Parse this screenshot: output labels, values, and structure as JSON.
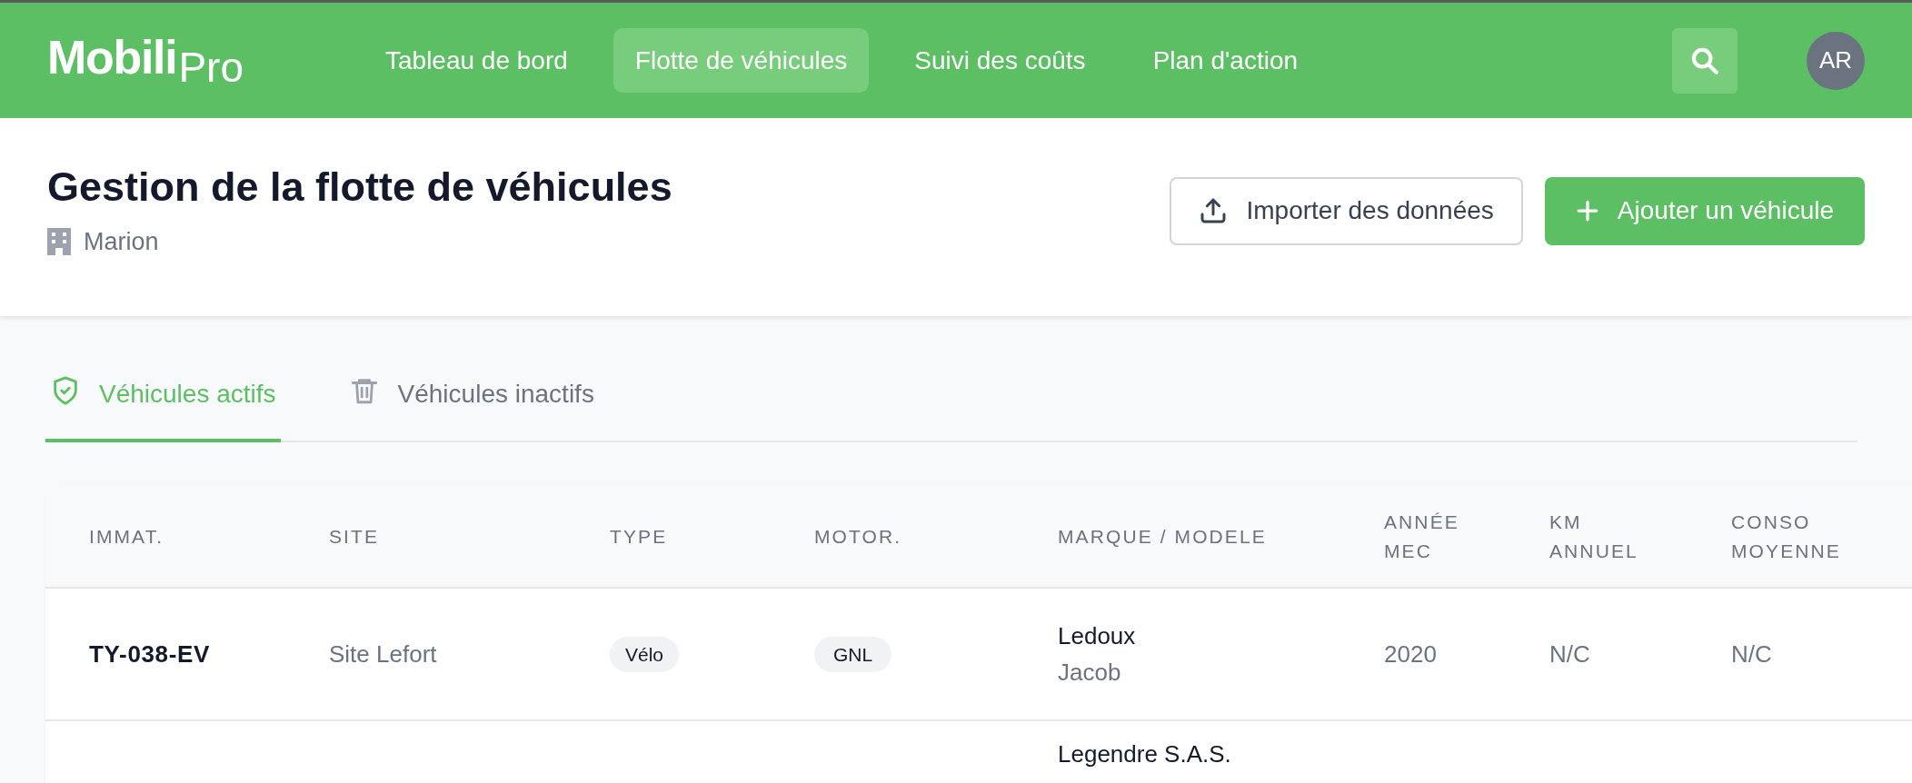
{
  "header": {
    "logo": {
      "main": "Mobili",
      "suffix": "Pro"
    },
    "nav": [
      {
        "label": "Tableau de bord",
        "selected": false
      },
      {
        "label": "Flotte de véhicules",
        "selected": true
      },
      {
        "label": "Suivi des coûts",
        "selected": false
      },
      {
        "label": "Plan d'action",
        "selected": false
      }
    ],
    "avatar": "AR"
  },
  "page": {
    "title": "Gestion de la flotte de véhicules",
    "site": "Marion",
    "buttons": [
      {
        "kind": "secondary",
        "label": "Importer des données"
      },
      {
        "kind": "primary",
        "label": "Ajouter un véhicule"
      }
    ]
  },
  "tabs": [
    {
      "label": "Véhicules actifs",
      "selected": true,
      "kind": "active"
    },
    {
      "label": "Véhicules inactifs",
      "selected": false,
      "kind": "inactive"
    }
  ],
  "table": {
    "columns": [
      [
        "IMMAT."
      ],
      [
        "SITE"
      ],
      [
        "TYPE"
      ],
      [
        "MOTOR."
      ],
      [
        "MARQUE / MODELE"
      ],
      [
        "ANNÉE",
        "MEC"
      ],
      [
        "KM",
        "ANNUEL"
      ],
      [
        "CONSO",
        "MOYENNE"
      ]
    ],
    "rows": [
      {
        "immat": "TY-038-EV",
        "site": "Site Lefort",
        "type": "Vélo",
        "motor": "GNL",
        "marque": "Ledoux",
        "modele": "Jacob",
        "annee": "2020",
        "km": "N/C",
        "conso": "N/C"
      },
      {
        "marque": "Legendre S.A.S."
      }
    ]
  }
}
